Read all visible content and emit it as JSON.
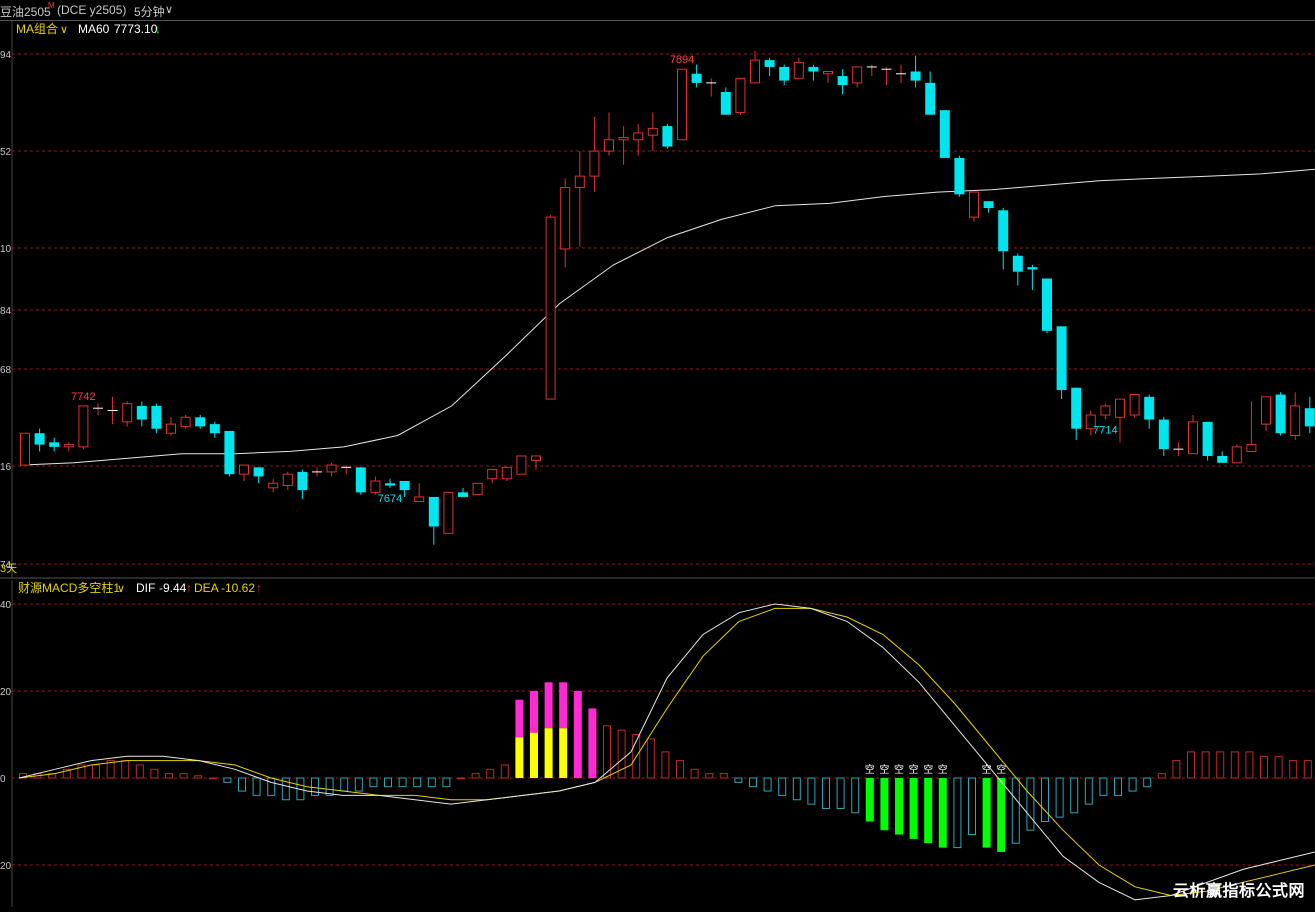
{
  "header": {
    "symbol": "豆油2505",
    "symbol_mark": "M",
    "exchange_code": "(DCE y2505)",
    "period": "5分钟",
    "period_caret": "∨"
  },
  "price_panel": {
    "indicator_label": "MA组合",
    "indicator_caret": "∨",
    "ma_label": "MA60",
    "ma_value": "7773.10",
    "ma_arrow": "↓",
    "days_label": "3天"
  },
  "macd_panel": {
    "indicator_label": "财源MACD多空柱1",
    "indicator_caret": "∨",
    "dif_label": "DIF",
    "dif_value": "-9.44",
    "dif_arrow": "↑",
    "dea_label": "DEA",
    "dea_value": "-10.62",
    "dea_arrow": "↑"
  },
  "watermark": "云析赢指标公式网",
  "colors": {
    "up": "#e03030",
    "down": "#00e5ee",
    "ma_line": "#e6e6e6",
    "dea_line": "#e6d200",
    "hist_pos_outline": "#c02828",
    "hist_neg_outline": "#2aa6b8",
    "hist_magenta": "#ff2ad2",
    "hist_yellow": "#ffff00",
    "hist_green": "#00ff00",
    "grid": "#8b1a1a",
    "axis_label": "#c8c8c8"
  },
  "chart_data": [
    {
      "type": "candlestick",
      "y_tick_labels": [
        "94",
        "52",
        "10",
        "84",
        "68",
        "16",
        "74"
      ],
      "annotations": [
        {
          "text": "7742",
          "kind": "high",
          "index": 4
        },
        {
          "text": "7894",
          "kind": "high",
          "index": 45
        },
        {
          "text": "7674",
          "kind": "low",
          "index": 25
        },
        {
          "text": "7714",
          "kind": "low",
          "index": 74
        }
      ],
      "ylim": [
        7665,
        7905
      ],
      "candles": [
        [
          7712,
          7726,
          7712,
          7725
        ],
        [
          7726,
          7721,
          7718,
          7728
        ],
        [
          7722,
          7720,
          7718,
          7724
        ],
        [
          7720,
          7721,
          7718,
          7722
        ],
        [
          7720,
          7738,
          7719,
          7738
        ],
        [
          7737,
          7737,
          7734,
          7739
        ],
        [
          7736,
          7736,
          7730,
          7742
        ],
        [
          7731,
          7739,
          7729,
          7740
        ],
        [
          7738,
          7732,
          7729,
          7740
        ],
        [
          7738,
          7728,
          7726,
          7739
        ],
        [
          7726,
          7730,
          7725,
          7733
        ],
        [
          7729,
          7733,
          7728,
          7734
        ],
        [
          7733,
          7729,
          7728,
          7734
        ],
        [
          7730,
          7726,
          7724,
          7731
        ],
        [
          7727,
          7708,
          7707,
          7727
        ],
        [
          7708,
          7712,
          7705,
          7712
        ],
        [
          7711,
          7707,
          7704,
          7711
        ],
        [
          7702,
          7704,
          7700,
          7706
        ],
        [
          7703,
          7708,
          7701,
          7709
        ],
        [
          7709,
          7701,
          7697,
          7710
        ],
        [
          7709,
          7709,
          7707,
          7711
        ],
        [
          7709,
          7712,
          7707,
          7713
        ],
        [
          7711,
          7711,
          7708,
          7712
        ],
        [
          7711,
          7700,
          7699,
          7711
        ],
        [
          7700,
          7705,
          7699,
          7707
        ],
        [
          7704,
          7703,
          7702,
          7706
        ],
        [
          7705,
          7701,
          7698,
          7705
        ],
        [
          7696,
          7698,
          7696,
          7704
        ],
        [
          7698,
          7685,
          7677,
          7698
        ],
        [
          7682,
          7700,
          7682,
          7700
        ],
        [
          7700,
          7698,
          7698,
          7702
        ],
        [
          7699,
          7704,
          7699,
          7704
        ],
        [
          7706,
          7710,
          7704,
          7710
        ],
        [
          7706,
          7711,
          7705,
          7711
        ],
        [
          7708,
          7716,
          7708,
          7716
        ],
        [
          7714,
          7716,
          7710,
          7716
        ],
        [
          7741,
          7821,
          7741,
          7822
        ],
        [
          7807,
          7834,
          7799,
          7838
        ],
        [
          7834,
          7839,
          7808,
          7850
        ],
        [
          7839,
          7850,
          7832,
          7865
        ],
        [
          7850,
          7855,
          7848,
          7867
        ],
        [
          7855,
          7856,
          7844,
          7861
        ],
        [
          7855,
          7858,
          7848,
          7862
        ],
        [
          7857,
          7860,
          7850,
          7867
        ],
        [
          7861,
          7852,
          7851,
          7862
        ],
        [
          7855,
          7886,
          7855,
          7886
        ],
        [
          7884,
          7880,
          7878,
          7888
        ],
        [
          7880,
          7880,
          7874,
          7882
        ],
        [
          7876,
          7866,
          7866,
          7878
        ],
        [
          7867,
          7882,
          7866,
          7882
        ],
        [
          7880,
          7890,
          7880,
          7894
        ],
        [
          7890,
          7887,
          7883,
          7891
        ],
        [
          7887,
          7881,
          7879,
          7888
        ],
        [
          7882,
          7889,
          7882,
          7891
        ],
        [
          7887,
          7885,
          7881,
          7888
        ],
        [
          7884,
          7885,
          7880,
          7885
        ],
        [
          7883,
          7879,
          7875,
          7886
        ],
        [
          7880,
          7887,
          7878,
          7887
        ],
        [
          7887,
          7887,
          7883,
          7888
        ],
        [
          7886,
          7886,
          7879,
          7887
        ],
        [
          7884,
          7884,
          7880,
          7888
        ],
        [
          7885,
          7881,
          7878,
          7892
        ],
        [
          7880,
          7866,
          7866,
          7885
        ],
        [
          7868,
          7847,
          7847,
          7868
        ],
        [
          7847,
          7831,
          7830,
          7848
        ],
        [
          7821,
          7832,
          7819,
          7832
        ],
        [
          7828,
          7825,
          7823,
          7828
        ],
        [
          7824,
          7806,
          7798,
          7825
        ],
        [
          7804,
          7797,
          7791,
          7805
        ],
        [
          7799,
          7798,
          7789,
          7800
        ],
        [
          7794,
          7771,
          7770,
          7794
        ],
        [
          7773,
          7745,
          7741,
          7773
        ],
        [
          7746,
          7728,
          7723,
          7746
        ],
        [
          7728,
          7734,
          7725,
          7736
        ],
        [
          7734,
          7738,
          7732,
          7739
        ],
        [
          7733,
          7741,
          7722,
          7741
        ],
        [
          7734,
          7743,
          7733,
          7743
        ],
        [
          7742,
          7732,
          7728,
          7743
        ],
        [
          7732,
          7719,
          7716,
          7733
        ],
        [
          7719,
          7719,
          7716,
          7722
        ],
        [
          7717,
          7731,
          7717,
          7734
        ],
        [
          7731,
          7716,
          7714,
          7731
        ],
        [
          7716,
          7713,
          7713,
          7718
        ],
        [
          7713,
          7720,
          7713,
          7721
        ],
        [
          7718,
          7721,
          7719,
          7740
        ],
        [
          7730,
          7742,
          7727,
          7742
        ],
        [
          7743,
          7726,
          7725,
          7744
        ],
        [
          7725,
          7738,
          7723,
          7744
        ],
        [
          7737,
          7729,
          7726,
          7742
        ],
        [
          7731,
          7731,
          7729,
          7732
        ],
        [
          7732,
          7722,
          7717,
          7732
        ],
        [
          7722,
          7733,
          7722,
          7733
        ],
        [
          7733,
          7722,
          7720,
          7734
        ],
        [
          7722,
          7733,
          7722,
          7733
        ],
        [
          7733,
          7734,
          7733,
          7743
        ]
      ],
      "ma60": [
        7712,
        7713,
        7715,
        7717,
        7717,
        7718,
        7720,
        7725,
        7738,
        7760,
        7783,
        7800,
        7812,
        7820,
        7826,
        7827,
        7830,
        7832,
        7833,
        7835,
        7837,
        7838,
        7839,
        7840,
        7842
      ]
    },
    {
      "type": "bar+line",
      "name": "MACD",
      "y_tick_labels": [
        "40",
        "20",
        "0",
        "20"
      ],
      "ylim": [
        -29,
        42
      ],
      "histogram": [
        1,
        1,
        1,
        2,
        3,
        3,
        4,
        4,
        3,
        2,
        1,
        1,
        0.5,
        0,
        -1,
        -3,
        -4,
        -4,
        -5,
        -5,
        -4,
        -4,
        -3,
        -3,
        -2,
        -2,
        -2,
        -2,
        -2,
        -2,
        0,
        1,
        2,
        3,
        18,
        20,
        22,
        22,
        20,
        16,
        12,
        11,
        10,
        9,
        6,
        4,
        2,
        1,
        1,
        -1,
        -2,
        -3,
        -4,
        -5,
        -6,
        -7,
        -7,
        -8,
        -10,
        -12,
        -13,
        -14,
        -15,
        -16,
        -16,
        -13,
        -16,
        -17,
        -15,
        -12,
        -10,
        -9,
        -8,
        -6,
        -4,
        -4,
        -3,
        -2,
        1,
        4,
        6,
        6,
        6,
        6,
        6,
        5,
        5,
        4,
        4,
        5,
        5,
        5,
        5,
        4,
        4,
        4
      ],
      "marks": {
        "magenta_yellow": [
          34,
          35,
          36,
          37
        ],
        "magenta_only": [
          38,
          39
        ],
        "green": [
          58,
          59,
          60,
          61,
          62,
          63,
          66,
          67
        ],
        "kong": [
          58,
          59,
          60,
          61,
          62,
          63,
          66,
          67
        ]
      },
      "kong_label": "空",
      "dif": [
        0,
        2,
        4,
        5,
        5,
        4,
        2,
        -1,
        -3,
        -4,
        -4,
        -5,
        -6,
        -5,
        -4,
        -3,
        -1,
        6,
        23,
        33,
        38,
        40,
        39,
        36,
        30,
        22,
        12,
        2,
        -8,
        -18,
        -24,
        -28,
        -27,
        -24,
        -21,
        -19,
        -17
      ],
      "dea": [
        0,
        1,
        3,
        4,
        4,
        4,
        3,
        0,
        -2,
        -3,
        -4,
        -4,
        -5,
        -5,
        -4,
        -3,
        -1,
        3,
        16,
        28,
        36,
        39,
        39,
        37,
        33,
        26,
        17,
        7,
        -3,
        -12,
        -20,
        -25,
        -27,
        -26,
        -24,
        -22,
        -20
      ]
    }
  ]
}
